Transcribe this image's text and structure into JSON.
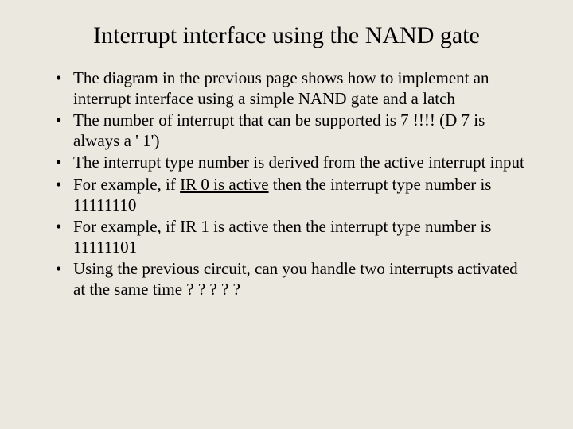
{
  "title": "Interrupt interface using the NAND gate",
  "bullets": [
    {
      "segments": [
        {
          "text": "The diagram in the previous page shows how to implement an interrupt interface using a simple NAND gate and a latch"
        }
      ]
    },
    {
      "segments": [
        {
          "text": "The number of interrupt that can be supported is 7    !!!! (D 7 is always a ' 1')"
        }
      ]
    },
    {
      "segments": [
        {
          "text": "The interrupt type number is derived from the active interrupt input"
        }
      ]
    },
    {
      "segments": [
        {
          "text": "For example, if "
        },
        {
          "text": "IR 0 is active",
          "underline": true
        },
        {
          "text": " then the interrupt type number is 11111110"
        }
      ]
    },
    {
      "segments": [
        {
          "text": "For example, if IR 1 is active then the interrupt type number is 11111101"
        }
      ]
    },
    {
      "segments": [
        {
          "text": "Using the previous circuit, can you handle two interrupts activated at the same time ? ? ? ? ?"
        }
      ]
    }
  ]
}
